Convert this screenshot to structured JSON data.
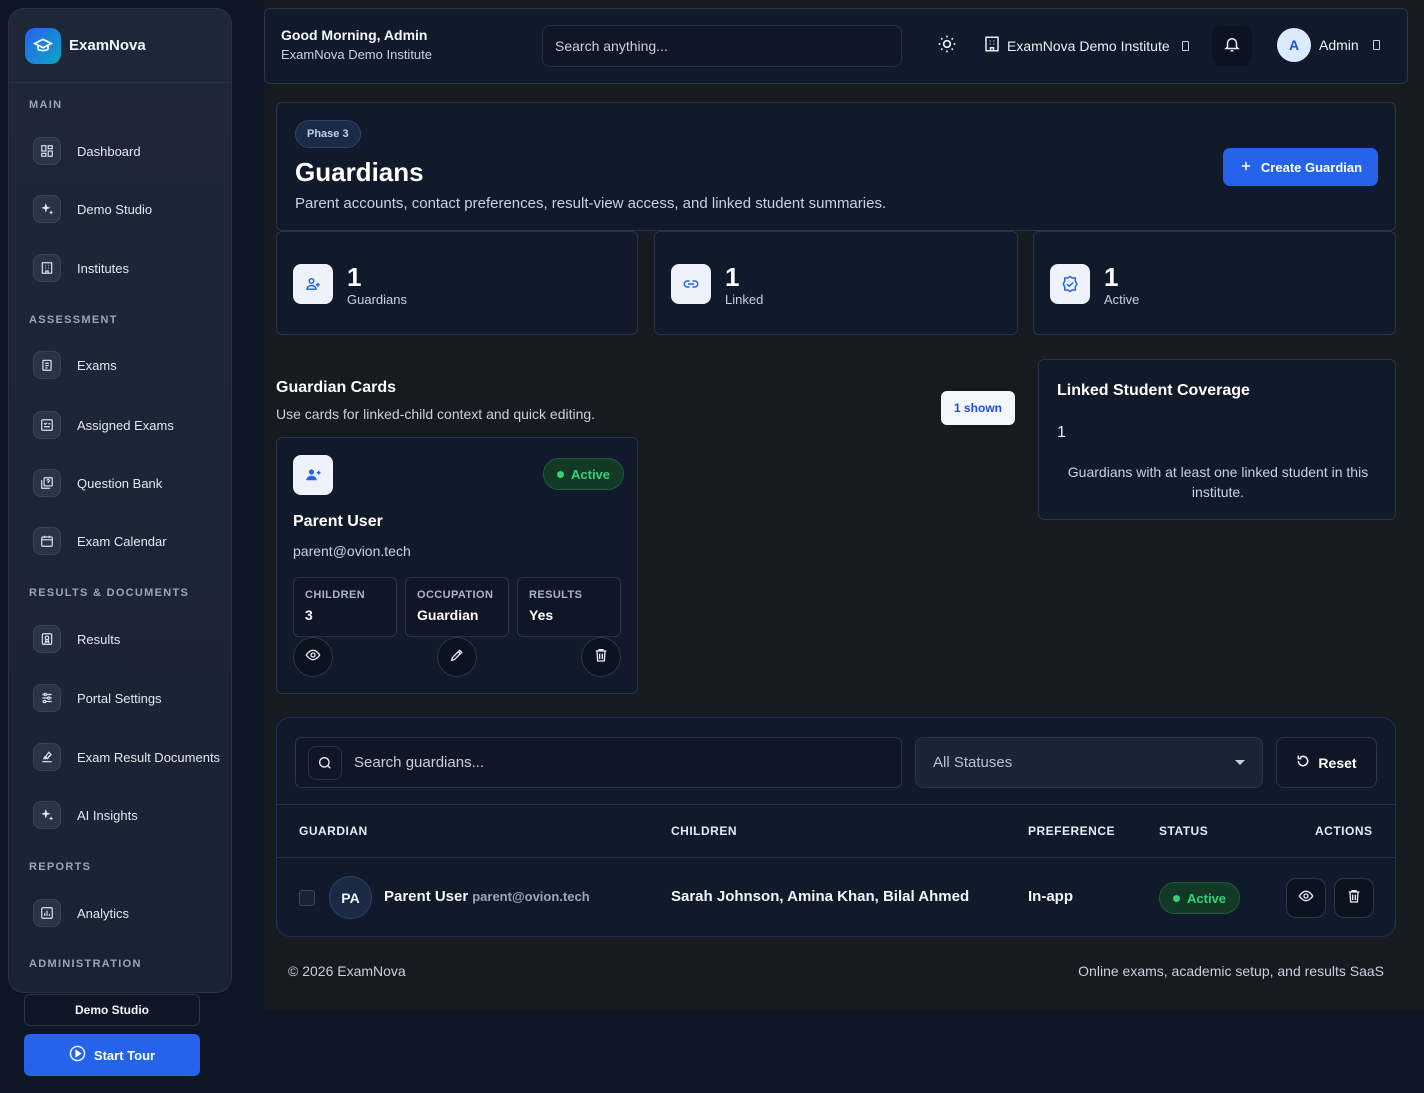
{
  "brand": {
    "name": "ExamNova"
  },
  "sidebar": {
    "sections": [
      {
        "title": "MAIN"
      },
      {
        "title": "ASSESSMENT"
      },
      {
        "title": "RESULTS & DOCUMENTS"
      },
      {
        "title": "REPORTS"
      },
      {
        "title": "ADMINISTRATION"
      }
    ],
    "items": [
      {
        "label": "Dashboard",
        "icon": "dashboard-icon"
      },
      {
        "label": "Demo Studio",
        "icon": "sparkles-icon"
      },
      {
        "label": "Institutes",
        "icon": "building-icon"
      },
      {
        "label": "Exams",
        "icon": "clipboard-icon"
      },
      {
        "label": "Assigned Exams",
        "icon": "checklist-icon"
      },
      {
        "label": "Question Bank",
        "icon": "question-bank-icon"
      },
      {
        "label": "Exam Calendar",
        "icon": "calendar-icon"
      },
      {
        "label": "Results",
        "icon": "award-icon"
      },
      {
        "label": "Portal Settings",
        "icon": "sliders-icon"
      },
      {
        "label": "Exam Result Documents",
        "icon": "document-sign-icon"
      },
      {
        "label": "AI Insights",
        "icon": "sparkles-icon"
      },
      {
        "label": "Analytics",
        "icon": "chart-icon"
      }
    ],
    "demo_studio_label": "Demo Studio",
    "start_tour_label": "Start Tour"
  },
  "topbar": {
    "greeting": "Good Morning, Admin",
    "institute_sub": "ExamNova Demo Institute",
    "search_placeholder": "Search anything...",
    "institute_selector": "ExamNova Demo Institute",
    "user_initial": "A",
    "user_name": "Admin"
  },
  "hero": {
    "phase": "Phase 3",
    "title": "Guardians",
    "subtitle": "Parent accounts, contact preferences, result-view access, and linked student summaries.",
    "create_label": "Create Guardian"
  },
  "stats": [
    {
      "value": "1",
      "label": "Guardians",
      "icon": "guardians-icon"
    },
    {
      "value": "1",
      "label": "Linked",
      "icon": "link-icon"
    },
    {
      "value": "1",
      "label": "Active",
      "icon": "verified-icon"
    }
  ],
  "cards_section": {
    "title": "Guardian Cards",
    "subtitle": "Use cards for linked-child context and quick editing.",
    "shown": "1 shown"
  },
  "guardian_card": {
    "status": "Active",
    "name": "Parent User",
    "email": "parent@ovion.tech",
    "fields": [
      {
        "key": "CHILDREN",
        "value": "3"
      },
      {
        "key": "OCCUPATION",
        "value": "Guardian"
      },
      {
        "key": "RESULTS",
        "value": "Yes"
      }
    ]
  },
  "coverage": {
    "title": "Linked Student Coverage",
    "value": "1",
    "description": "Guardians with at least one linked student in this institute."
  },
  "table": {
    "search_placeholder": "Search guardians...",
    "status_filter": "All Statuses",
    "reset_label": "Reset",
    "headers": [
      "GUARDIAN",
      "CHILDREN",
      "PREFERENCE",
      "STATUS",
      "ACTIONS"
    ],
    "rows": [
      {
        "initials": "PA",
        "name": "Parent User",
        "email": "parent@ovion.tech",
        "children": "Sarah Johnson, Amina Khan, Bilal Ahmed",
        "preference": "In-app",
        "status": "Active"
      }
    ]
  },
  "footer": {
    "left": "© 2026 ExamNova",
    "right": "Online exams, academic setup, and results SaaS"
  },
  "colors": {
    "accent": "#2563eb",
    "success": "#37d17a",
    "panel": "#111a2a",
    "background": "#0e1625"
  }
}
